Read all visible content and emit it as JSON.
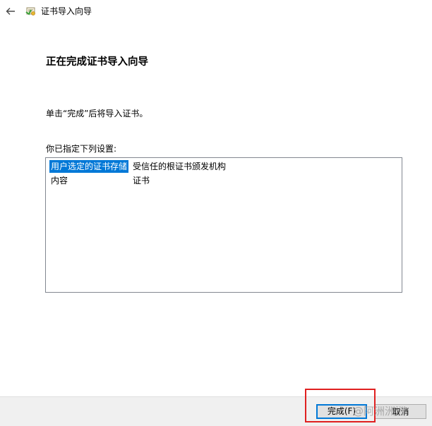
{
  "window": {
    "title": "证书导入向导",
    "back_icon": "arrow-left-icon",
    "app_icon": "certificate-icon"
  },
  "wizard": {
    "heading": "正在完成证书导入向导",
    "instruction": "单击“完成”后将导入证书。",
    "settings_label": "你已指定下列设置:",
    "settings": [
      {
        "key": "用户选定的证书存储",
        "value": "受信任的根证书颁发机构",
        "selected": true
      },
      {
        "key": "内容",
        "value": "证书",
        "selected": false
      }
    ]
  },
  "footer": {
    "finish_label": "完成(F)",
    "cancel_label": "取消"
  },
  "watermark": {
    "text": "@阿洲洲洲"
  },
  "colors": {
    "selection": "#0078d7",
    "highlight": "#e02020",
    "footer_bg": "#f0f0f0"
  }
}
